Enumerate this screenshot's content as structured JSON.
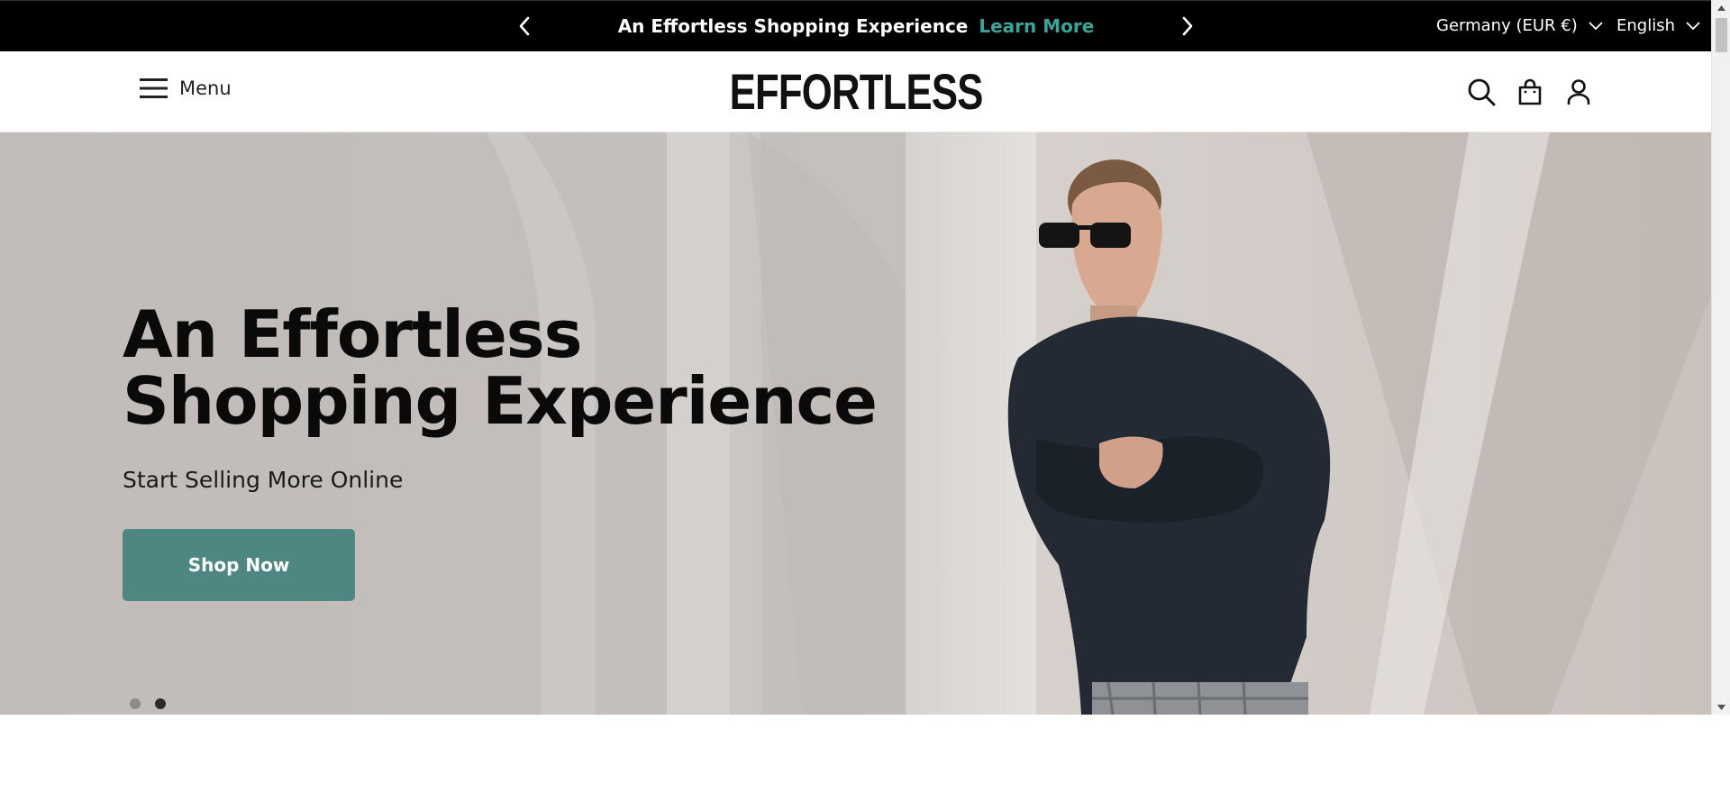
{
  "announcement": {
    "message": "An Effortless Shopping Experience",
    "link_label": "Learn More",
    "link_color": "#3aa59a",
    "prev_icon": "chevron-left-icon",
    "next_icon": "chevron-right-icon"
  },
  "locale": {
    "country": "Germany (EUR €)",
    "language": "English"
  },
  "header": {
    "menu_label": "Menu",
    "logo_text": "EFFORTLESS",
    "icons": [
      "search-icon",
      "shopping-bag-icon",
      "account-icon"
    ]
  },
  "hero": {
    "title_line1": "An Effortless",
    "title_line2": "Shopping Experience",
    "subtitle": "Start Selling More Online",
    "cta_label": "Shop Now",
    "cta_color": "#4e8781",
    "slides_total": 2,
    "active_slide": 2
  }
}
